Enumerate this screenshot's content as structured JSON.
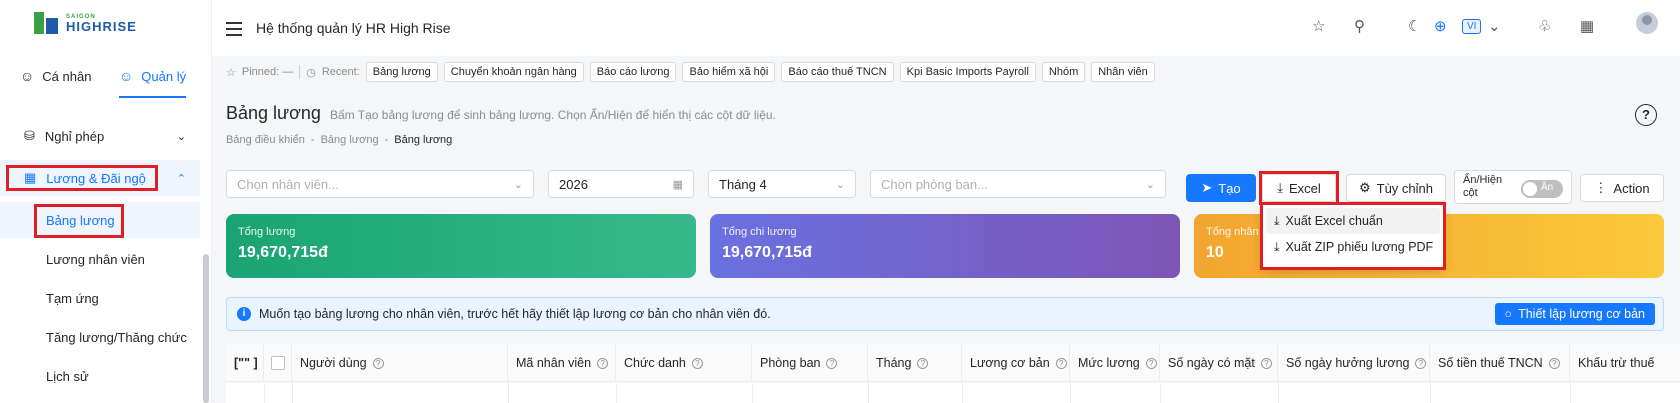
{
  "brand": {
    "name_top": "SAIGON",
    "name_bottom": "HIGHRISE"
  },
  "sidebar": {
    "tabs": [
      {
        "label": "Cá nhân",
        "icon": "user-icon"
      },
      {
        "label": "Quản lý",
        "icon": "user-icon"
      }
    ],
    "items": [
      {
        "label": "Nghỉ phép",
        "icon": "car-icon"
      },
      {
        "label": "Lương & Đãi ngộ",
        "icon": "calendar-card-icon"
      }
    ],
    "sub_items": [
      "Bảng lương",
      "Lương nhân viên",
      "Tạm ứng",
      "Tăng lương/Thăng chức",
      "Lịch sử"
    ]
  },
  "header": {
    "title": "Hệ thống quản lý HR High Rise",
    "lang": "VI"
  },
  "pinbar": {
    "pinned_label": "Pinned: —",
    "recent_label": "Recent:",
    "recent": [
      "Bảng lương",
      "Chuyển khoản ngân hàng",
      "Báo cáo lương",
      "Bảo hiểm xã hội",
      "Báo cáo thuế TNCN",
      "Kpi Basic Imports Payroll",
      "Nhóm",
      "Nhân viên"
    ]
  },
  "page": {
    "title": "Bảng lương",
    "description": "Bấm Tạo bảng lương để sinh bảng lương. Chọn Ẩn/Hiện để hiển thị các cột dữ liệu.",
    "breadcrumb": [
      "Bảng điều khiển",
      "Bảng lương",
      "Bảng lương"
    ],
    "help": "?"
  },
  "filters": {
    "employee_placeholder": "Chọn nhân viên...",
    "year": "2026",
    "month": "Tháng 4",
    "department_placeholder": "Chọn phòng ban..."
  },
  "toolbar": {
    "create": "Tạo",
    "excel": "Excel",
    "customize": "Tùy chỉnh",
    "show_hide": "Ẩn/Hiện cột",
    "toggle_text": "Ẩn",
    "action": "Action"
  },
  "excel_menu": [
    {
      "label": "Xuất Excel chuẩn"
    },
    {
      "label": "Xuất ZIP phiếu lương PDF"
    }
  ],
  "cards": [
    {
      "label": "Tổng lương",
      "value": "19,670,715đ"
    },
    {
      "label": "Tổng chi lương",
      "value": "19,670,715đ"
    },
    {
      "label": "Tổng nhân v",
      "value": "10"
    }
  ],
  "info": {
    "message": "Muốn tạo bảng lương cho nhân viên, trước hết hãy thiết lập lương cơ bản cho nhân viên đó.",
    "button": "Thiết lập lương cơ bản"
  },
  "table": {
    "columns": [
      "[\"\" ]",
      "Người dùng",
      "Mã nhân viên",
      "Chức danh",
      "Phòng ban",
      "Tháng",
      "Lương cơ bản",
      "Mức lương",
      "Số ngày có mặt",
      "Số ngày hưởng lương",
      "Số tiền thuế TNCN",
      "Khấu trừ thuế"
    ]
  },
  "colors": {
    "accent": "#1677ff",
    "highlight": "#e01e26"
  }
}
